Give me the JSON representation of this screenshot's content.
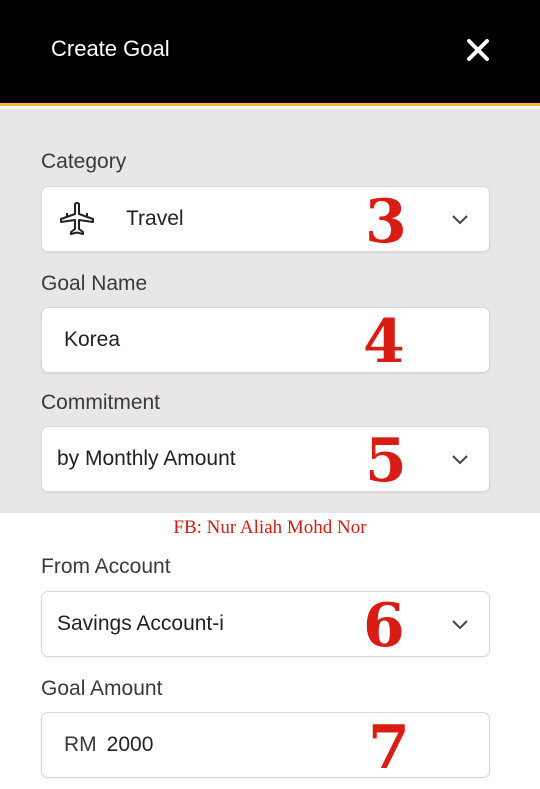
{
  "header": {
    "title": "Create Goal",
    "close_icon": "close-icon"
  },
  "form": {
    "category": {
      "label": "Category",
      "value": "Travel",
      "icon": "airplane-icon"
    },
    "goal_name": {
      "label": "Goal Name",
      "value": "Korea"
    },
    "commitment": {
      "label": "Commitment",
      "value": "by Monthly Amount"
    },
    "from_account": {
      "label": "From Account",
      "value": "Savings Account-i"
    },
    "goal_amount": {
      "label": "Goal Amount",
      "currency": "RM",
      "value": "2000"
    }
  },
  "annotations": {
    "step3": "3",
    "step4": "4",
    "step5": "5",
    "step6": "6",
    "step7": "7",
    "watermark": "FB: Nur Aliah Mohd Nor",
    "color": "#d91c14"
  },
  "colors": {
    "header_bg": "#000000",
    "accent": "#f2b733",
    "upper_bg": "#e8e6e9"
  }
}
